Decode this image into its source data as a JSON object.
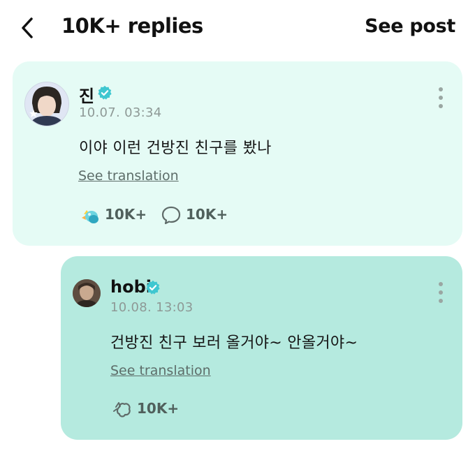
{
  "header": {
    "title": "10K+ replies",
    "see_post_label": "See post"
  },
  "post": {
    "author": "진",
    "verified": true,
    "timestamp": "10.07. 03:34",
    "text": "이야 이런 건방진 친구를 봤나",
    "see_translation_label": "See translation",
    "reaction_count": "10K+",
    "comment_count": "10K+"
  },
  "reply": {
    "author": "hobi",
    "verified": true,
    "timestamp": "10.08. 13:03",
    "text": "건방진 친구 보러 올거야~ 안올거야~",
    "see_translation_label": "See translation",
    "reaction_count": "10K+"
  },
  "colors": {
    "post_card_bg": "#e5fbf5",
    "reply_card_bg": "#b5eadf",
    "verified_badge": "#3fc7d0",
    "icon_grey": "#5f6b69"
  },
  "icons": {
    "back": "chevron-left-icon",
    "verified": "verified-badge-icon",
    "more": "more-vertical-icon",
    "reaction": "reaction-icon",
    "comment": "comment-icon"
  }
}
